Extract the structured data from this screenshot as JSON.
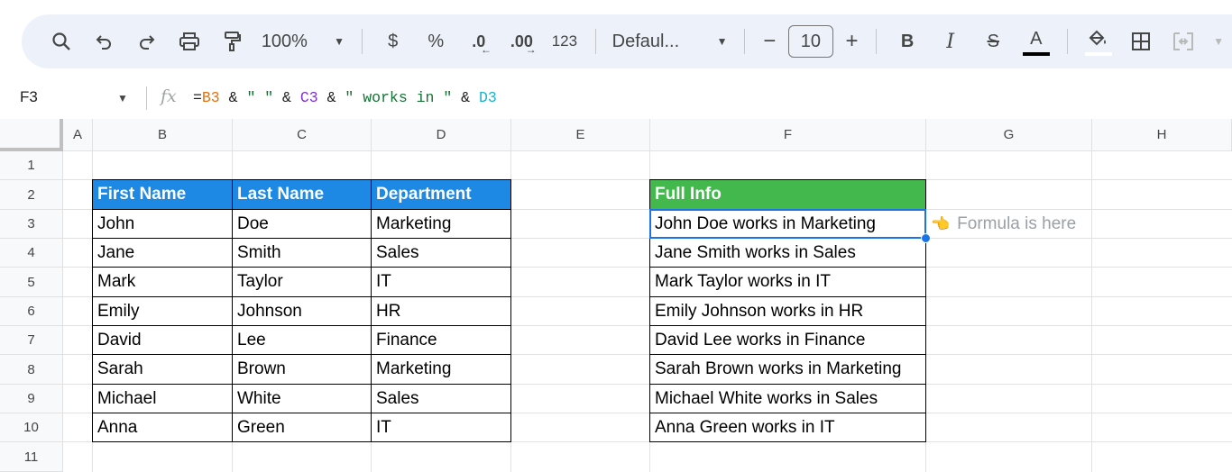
{
  "toolbar": {
    "zoom": "100%",
    "currency": "$",
    "percent": "%",
    "decrease_decimal": ".0",
    "increase_decimal": ".00",
    "number_format": "123",
    "font": "Defaul...",
    "font_size": "10",
    "bold": "B",
    "italic": "I",
    "strike": "S",
    "text_color": "A",
    "minus": "−",
    "plus": "+"
  },
  "formula_bar": {
    "cell_ref": "F3",
    "fx": "fx",
    "parts": [
      "=",
      "B3",
      " & ",
      "\" \"",
      " & ",
      "C3",
      " & ",
      "\" works in \"",
      " & ",
      "D3"
    ]
  },
  "columns": [
    "A",
    "B",
    "C",
    "D",
    "E",
    "F",
    "G",
    "H"
  ],
  "rows": [
    "1",
    "2",
    "3",
    "4",
    "5",
    "6",
    "7",
    "8",
    "9",
    "10",
    "11"
  ],
  "table": {
    "headers": [
      "First Name",
      "Last Name",
      "Department"
    ],
    "data": [
      [
        "John",
        "Doe",
        "Marketing"
      ],
      [
        "Jane",
        "Smith",
        "Sales"
      ],
      [
        "Mark",
        "Taylor",
        "IT"
      ],
      [
        "Emily",
        "Johnson",
        "HR"
      ],
      [
        "David",
        "Lee",
        "Finance"
      ],
      [
        "Sarah",
        "Brown",
        "Marketing"
      ],
      [
        "Michael",
        "White",
        "Sales"
      ],
      [
        "Anna",
        "Green",
        "IT"
      ]
    ]
  },
  "full_info": {
    "header": "Full Info",
    "values": [
      "John Doe works in Marketing",
      "Jane Smith works in Sales",
      "Mark Taylor works in IT",
      "Emily Johnson works in HR",
      "David Lee works in Finance",
      "Sarah Brown works in Marketing",
      "Michael White works in Sales",
      "Anna Green works in IT"
    ]
  },
  "note": "Formula is here",
  "colors": {
    "header_blue": "#1e88e5",
    "header_green": "#43b94d",
    "selection": "#1a73e8"
  }
}
